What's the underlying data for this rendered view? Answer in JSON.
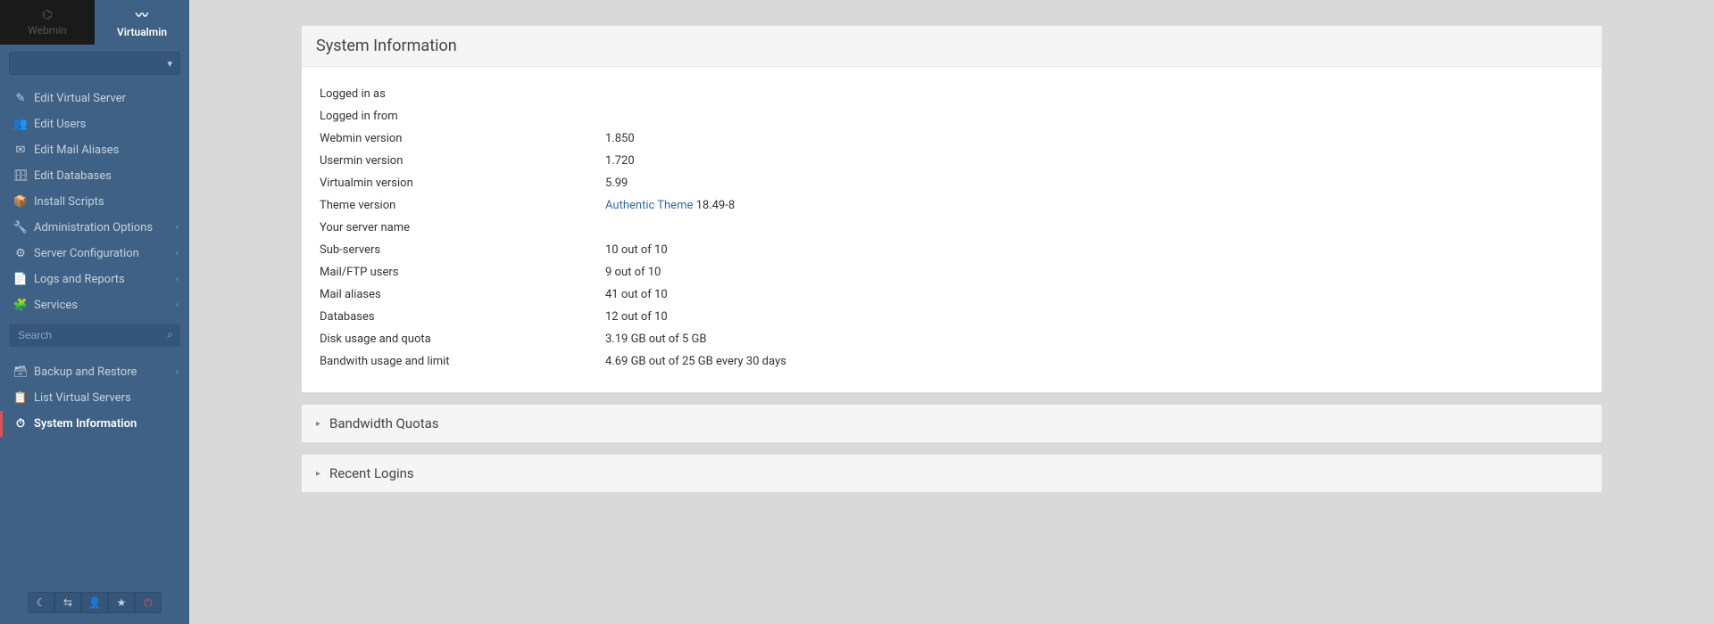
{
  "tabs": {
    "inactive": "Webmin",
    "active": "Virtualmin"
  },
  "sidebar": {
    "items": [
      {
        "icon": "✎",
        "label": "Edit Virtual Server"
      },
      {
        "icon": "👥",
        "label": "Edit Users"
      },
      {
        "icon": "✉",
        "label": "Edit Mail Aliases"
      },
      {
        "icon": "🗄",
        "label": "Edit Databases"
      },
      {
        "icon": "📦",
        "label": "Install Scripts"
      },
      {
        "icon": "🔧",
        "label": "Administration Options",
        "expandable": true
      },
      {
        "icon": "⚙",
        "label": "Server Configuration",
        "expandable": true
      },
      {
        "icon": "📄",
        "label": "Logs and Reports",
        "expandable": true
      },
      {
        "icon": "🧩",
        "label": "Services",
        "expandable": true
      }
    ],
    "search_placeholder": "Search",
    "items2": [
      {
        "icon": "🗃",
        "label": "Backup and Restore",
        "expandable": true
      },
      {
        "icon": "📋",
        "label": "List Virtual Servers"
      },
      {
        "icon": "⏱",
        "label": "System Information",
        "active": true
      }
    ]
  },
  "bottom_icons": [
    "moon-icon",
    "share-icon",
    "user-icon",
    "star-icon",
    "power-icon"
  ],
  "panel": {
    "title": "System Information",
    "rows": [
      {
        "label": "Logged in as",
        "value": ""
      },
      {
        "label": "Logged in from",
        "value": ""
      },
      {
        "label": "Webmin version",
        "value": "1.850"
      },
      {
        "label": "Usermin version",
        "value": "1.720"
      },
      {
        "label": "Virtualmin version",
        "value": "5.99"
      },
      {
        "label": "Theme version",
        "link": "Authentic Theme",
        "value": " 18.49-8"
      },
      {
        "label": "Your server name",
        "value": ""
      },
      {
        "label": "Sub-servers",
        "value": "10 out of 10"
      },
      {
        "label": "Mail/FTP users",
        "value": "9 out of 10"
      },
      {
        "label": "Mail aliases",
        "value": "41 out of 10"
      },
      {
        "label": "Databases",
        "value": "12 out of 10"
      },
      {
        "label": "Disk usage and quota",
        "value": "3.19 GB out of 5 GB"
      },
      {
        "label": "Bandwith usage and limit",
        "value": "4.69 GB out of 25 GB every 30 days"
      }
    ]
  },
  "collapsed_panels": [
    {
      "title": "Bandwidth Quotas"
    },
    {
      "title": "Recent Logins"
    }
  ]
}
